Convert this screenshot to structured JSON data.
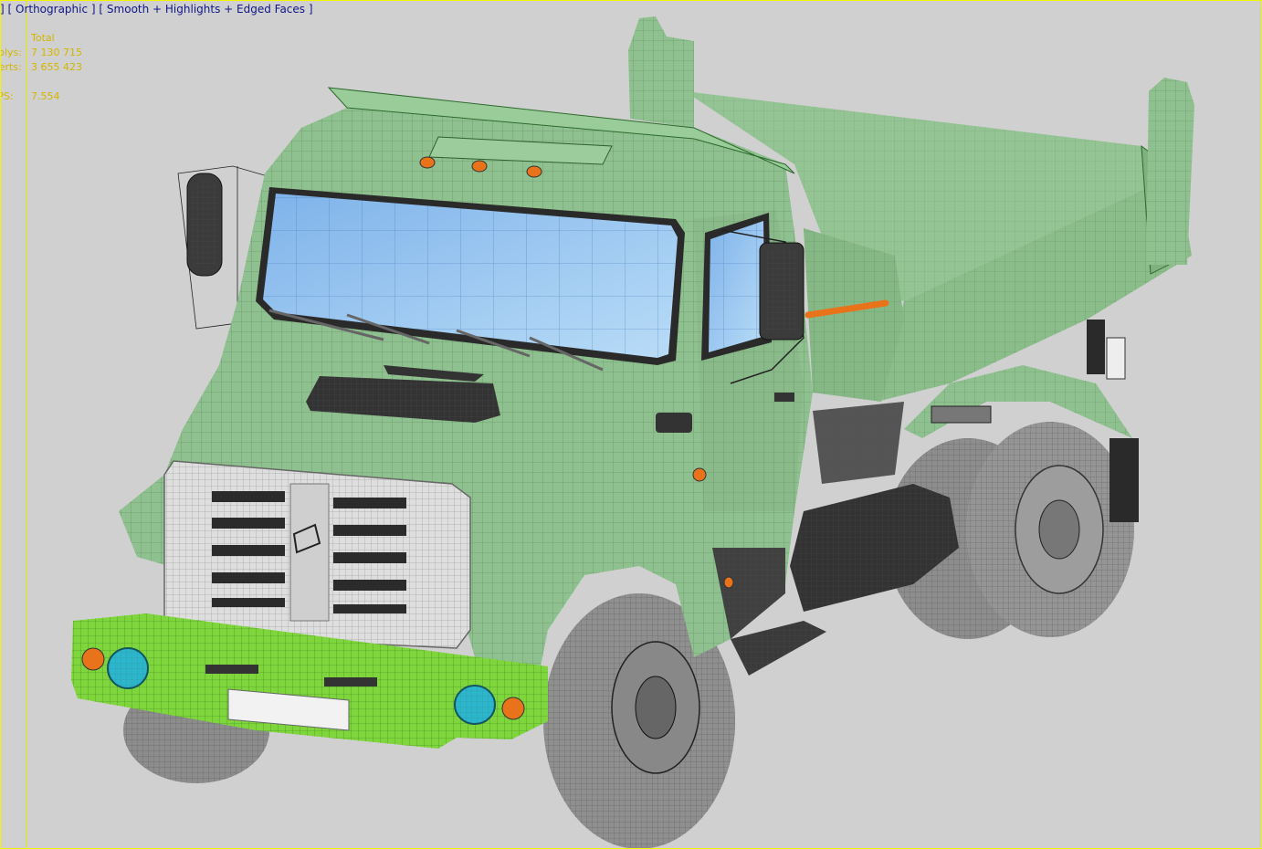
{
  "viewport": {
    "label_prefix": "] ",
    "view_mode": "[ Orthographic ]",
    "separator": " ",
    "shading_mode": "[ Smooth + Highlights + Edged Faces ]"
  },
  "stats": {
    "header": "Total",
    "polys_label": "Polys:",
    "polys_value": "7 130 715",
    "verts_label": "Verts:",
    "verts_value": "3 655 423",
    "fps_label": "FPS:",
    "fps_value": "7.554"
  },
  "colors": {
    "background": "#d0d0d0",
    "body_green": "#8fc08f",
    "bumper_green": "#7ed63c",
    "glass_blue": "#9cc8ef",
    "tire_gray": "#8a8a8a",
    "headlight_cyan": "#2bb6cc",
    "amber": "#e8731a",
    "label_blue": "#10178a",
    "stats_yellow": "#d3b500"
  }
}
